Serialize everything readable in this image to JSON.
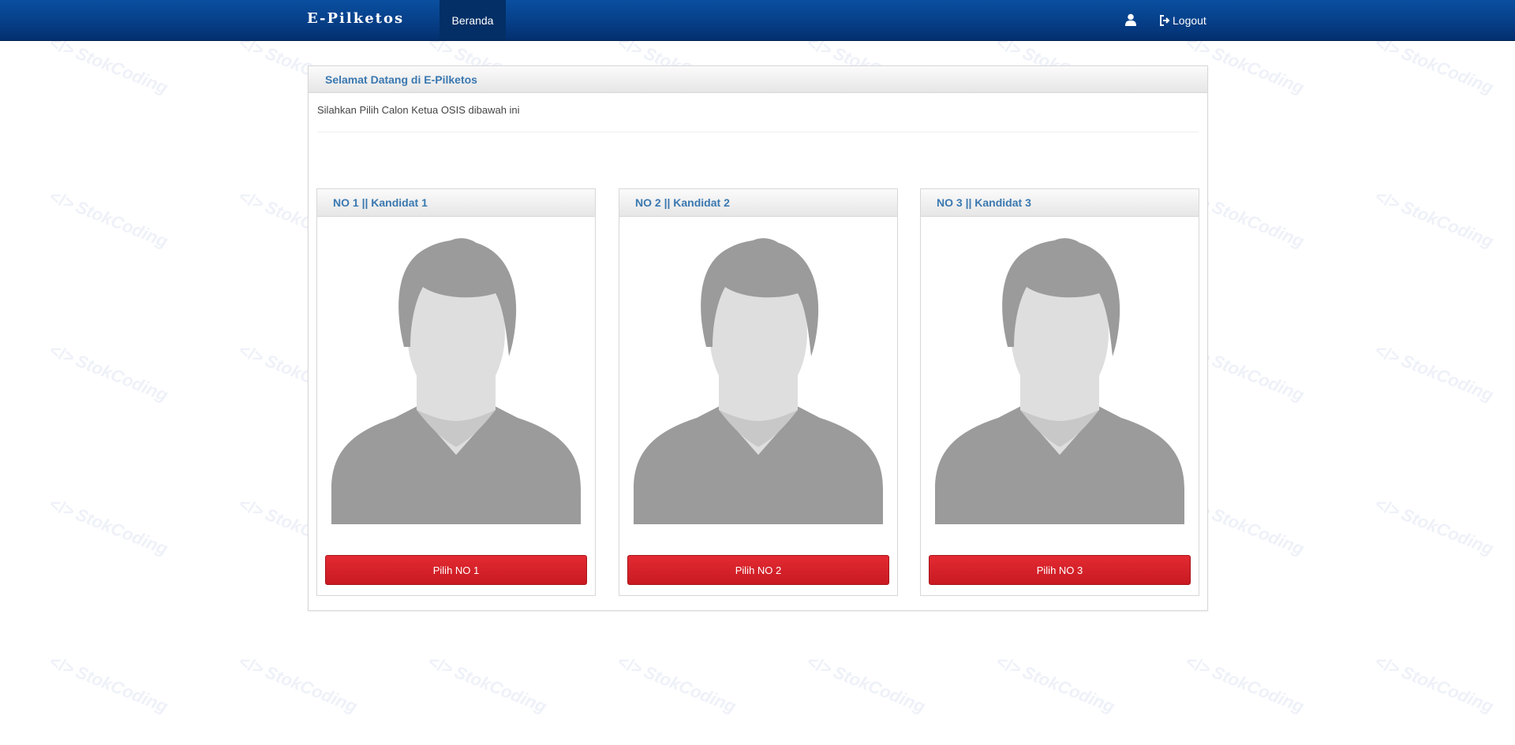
{
  "navbar": {
    "brand": "E-Pilketos",
    "active_item": "Beranda",
    "user_icon": "user-icon",
    "logout_icon": "logout-icon",
    "logout_label": "Logout"
  },
  "panel": {
    "title": "Selamat Datang di E-Pilketos",
    "intro": "Silahkan Pilih Calon Ketua OSIS dibawah ini"
  },
  "candidates": [
    {
      "title": "NO 1 || Kandidat 1",
      "button": "Pilih NO 1"
    },
    {
      "title": "NO 2 || Kandidat 2",
      "button": "Pilih NO 2"
    },
    {
      "title": "NO 3 || Kandidat 3",
      "button": "Pilih NO 3"
    }
  ],
  "watermark": "StokCoding",
  "colors": {
    "navbar": "#063f88",
    "nav_active": "#032f66",
    "heading_text": "#3a78b0",
    "vote_button": "#c81a22"
  }
}
